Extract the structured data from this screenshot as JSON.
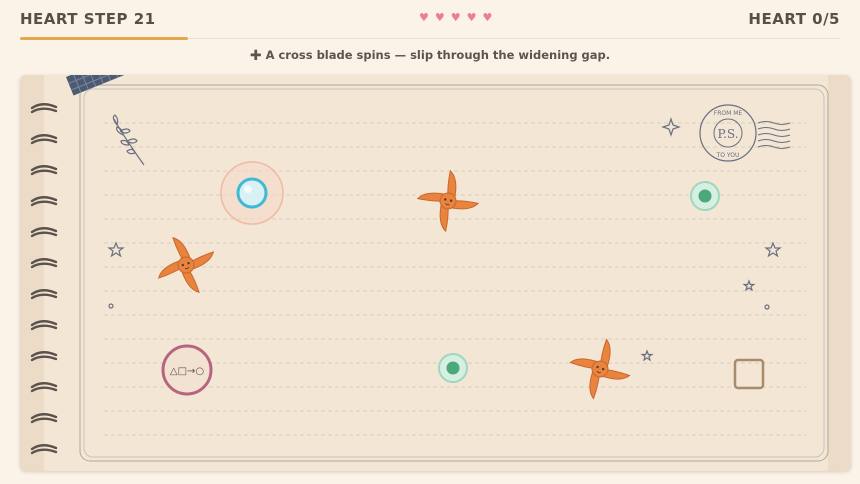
{
  "header": {
    "step_title": "HEART STEP 21",
    "hearts": [
      "♥",
      "♥",
      "♥",
      "♥",
      "♥"
    ],
    "heart_counter": "HEART 0/5",
    "progress_fraction": 0.2
  },
  "hint": {
    "icon": "plus-icon",
    "glyph": "✚",
    "text": "A cross blade spins — slip through the widening gap."
  },
  "board": {
    "stamp_text_top": "FROM ME",
    "stamp_text_center": "P.S.",
    "stamp_text_bottom": "TO YOU",
    "portal_symbols": "△□→○",
    "colors": {
      "player": "#3fb9d4",
      "goal": "#6bbf99",
      "portal": "#b7657f",
      "blade": "#e8843e",
      "accent": "#e2a94f"
    }
  }
}
